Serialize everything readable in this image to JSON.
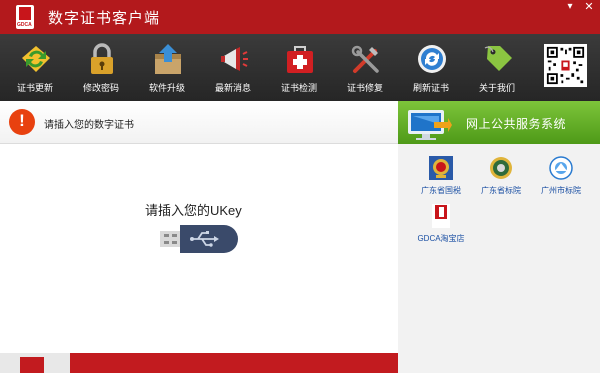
{
  "window": {
    "title": "数字证书客户端",
    "logo_text": "GDCA",
    "menu_glyph": "▾",
    "close_glyph": "✕"
  },
  "toolbar": {
    "items": [
      {
        "label": "证书更新",
        "icon": "update-arrows-icon"
      },
      {
        "label": "修改密码",
        "icon": "padlock-icon"
      },
      {
        "label": "软件升级",
        "icon": "box-upgrade-icon"
      },
      {
        "label": "最新消息",
        "icon": "megaphone-icon"
      },
      {
        "label": "证书检测",
        "icon": "first-aid-kit-icon"
      },
      {
        "label": "证书修复",
        "icon": "tools-icon"
      },
      {
        "label": "刷新证书",
        "icon": "refresh-icon"
      },
      {
        "label": "关于我们",
        "icon": "tag-icon"
      }
    ]
  },
  "notice": {
    "text": "请插入您的数字证书",
    "icon": "exclamation-icon"
  },
  "main": {
    "prompt": "请插入您的UKey",
    "illustration": "usb-key-icon"
  },
  "services": {
    "title": "网上公共服务系统",
    "links": [
      {
        "label": "广东省国税",
        "icon": "national-tax-emblem-icon"
      },
      {
        "label": "广东省标院",
        "icon": "standards-institute-emblem-icon"
      },
      {
        "label": "广州市标院",
        "icon": "guangzhou-standards-emblem-icon"
      },
      {
        "label": "GDCA淘宝店",
        "icon": "gdca-shop-icon",
        "logo_text": "GDCA"
      }
    ]
  },
  "colors": {
    "titlebar": "#b3191c",
    "toolbar": "#2e2e2e",
    "services_banner": "#5fae22",
    "link": "#1a4fa3",
    "alert": "#e8410f"
  }
}
